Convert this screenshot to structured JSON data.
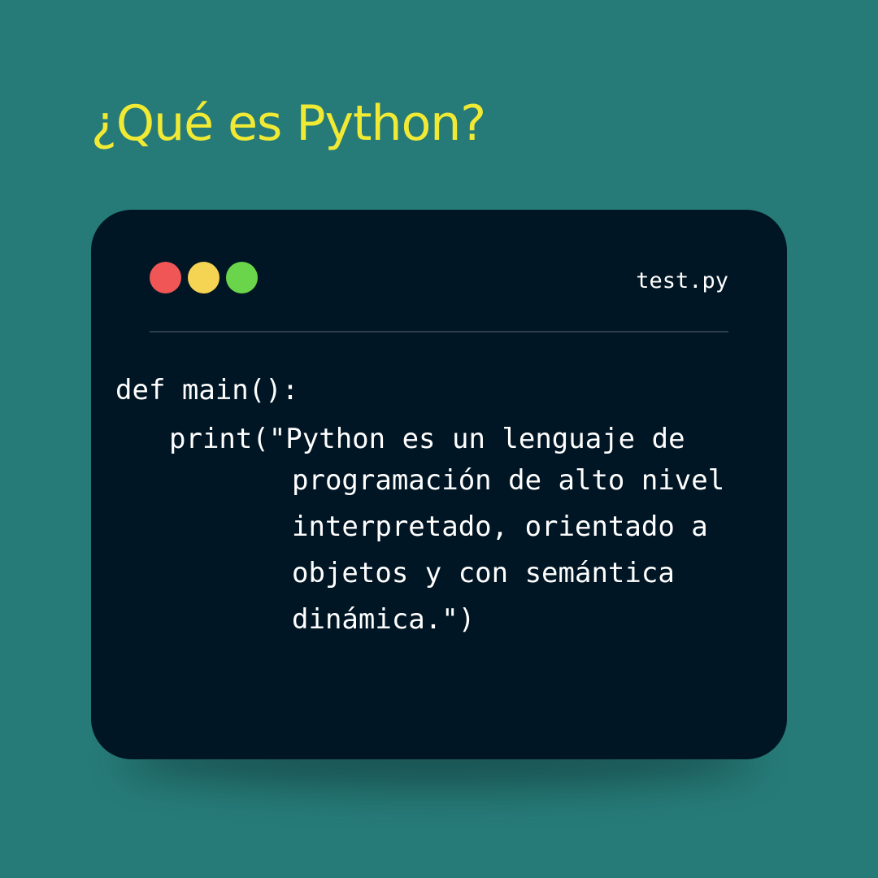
{
  "heading": "¿Qué es Python?",
  "window": {
    "filename": "test.py",
    "controls": {
      "close_color": "#f05656",
      "minimize_color": "#f5d453",
      "maximize_color": "#6ad54a"
    },
    "code": {
      "line1": "def main():",
      "line2": "print(\"Python es un lenguaje de",
      "continuation": [
        "programación de alto nivel",
        "interpretado, orientado a",
        "objetos y con semántica",
        "dinámica.\")"
      ]
    }
  },
  "colors": {
    "background": "#267a77",
    "heading": "#f1ea35",
    "window": "#011624",
    "code_text": "#ffffff"
  }
}
